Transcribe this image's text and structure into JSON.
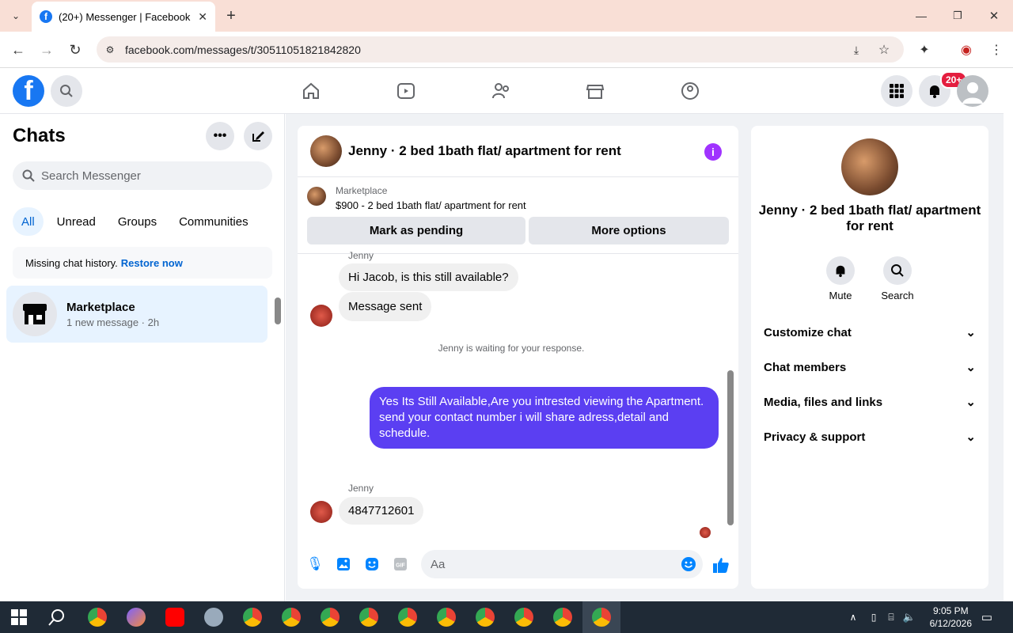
{
  "browser": {
    "tab_title": "(20+) Messenger | Facebook",
    "url": "facebook.com/messages/t/30511051821842820"
  },
  "header": {
    "notification_badge": "20+"
  },
  "sidebar": {
    "title": "Chats",
    "search_placeholder": "Search Messenger",
    "filters": [
      "All",
      "Unread",
      "Groups",
      "Communities"
    ],
    "missing_text": "Missing chat history.",
    "restore_link": "Restore now",
    "chats": [
      {
        "name": "Marketplace",
        "subtitle": "1 new message · 2h"
      }
    ]
  },
  "conversation": {
    "title": "Jenny · 2 bed 1bath flat/ apartment for rent",
    "marketplace_label": "Marketplace",
    "listing": "$900 - 2 bed 1bath flat/ apartment for rent",
    "mark_pending": "Mark as pending",
    "more_options": "More options",
    "messages": {
      "sender1": "Jenny",
      "msg1": "Hi Jacob, is this still available?",
      "msg2": "Message sent",
      "waiting": "Jenny is waiting for your response.",
      "sent": "Yes Its Still Available,Are you intrested viewing the Apartment. send your contact number i will share adress,detail and schedule.",
      "sender2": "Jenny",
      "msg3": "4847712601"
    },
    "composer_placeholder": "Aa"
  },
  "info_panel": {
    "name": "Jenny · 2 bed 1bath flat/ apartment for rent",
    "mute": "Mute",
    "search": "Search",
    "sections": [
      "Customize chat",
      "Chat members",
      "Media, files and links",
      "Privacy & support"
    ]
  },
  "taskbar": {
    "time": "9:05 PM",
    "date": "6/12/2026"
  },
  "colors": {
    "brand": "#1877f2",
    "sent_bubble": "#5b3ff2",
    "accent_icons": "#0084ff"
  }
}
